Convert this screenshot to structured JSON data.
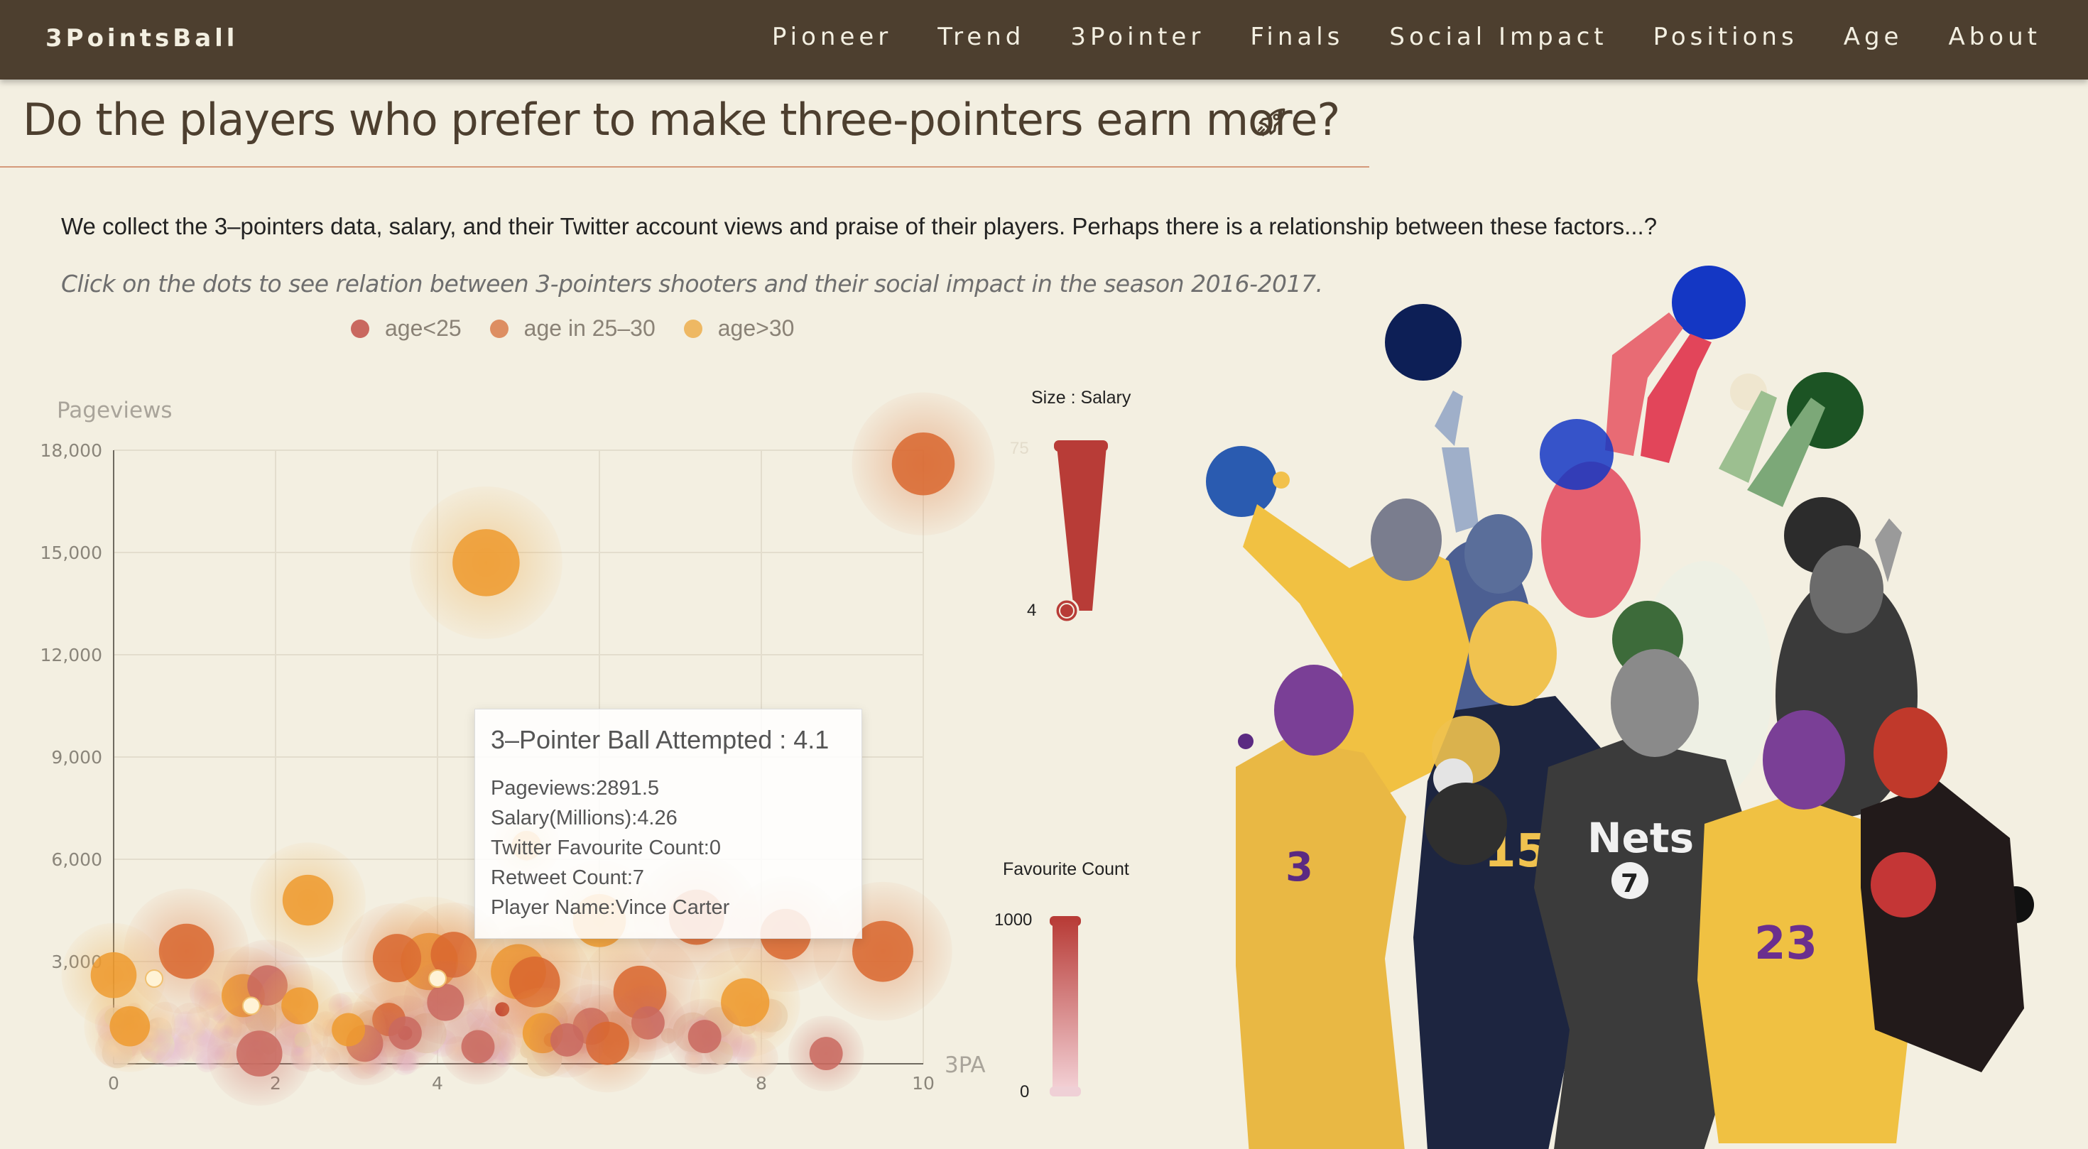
{
  "nav": {
    "brand": "3PointsBall",
    "links": [
      "Pioneer",
      "Trend",
      "3Pointer",
      "Finals",
      "Social Impact",
      "Positions",
      "Age",
      "About"
    ]
  },
  "header": {
    "title": "Do the players who prefer to make three-pointers earn more?",
    "intro": "We collect the 3–pointers data, salary, and their Twitter account views and praise of their players. Perhaps there is a relationship between these factors...?",
    "hint": "Click on the dots to see relation between 3-pointers shooters and their social impact in the season 2016-2017."
  },
  "legend": [
    {
      "label": "age<25",
      "color": "#c9685f"
    },
    {
      "label": "age in 25–30",
      "color": "#dd8e62"
    },
    {
      "label": "age>30",
      "color": "#eeb863"
    }
  ],
  "size_map": {
    "title": "Size : Salary",
    "max": "75",
    "min": "4"
  },
  "favourite_map": {
    "title": "Favourite Count",
    "max": "1000",
    "min": "0"
  },
  "tooltip": {
    "title": "3–Pointer Ball Attempted : 4.1",
    "lines": [
      "Pageviews:2891.5",
      "Salary(Millions):4.26",
      "Twitter Favourite Count:0",
      "Retweet Count:7",
      "Player Name:Vince Carter"
    ]
  },
  "chart_data": {
    "type": "scatter",
    "xlabel": "3PA",
    "ylabel": "Pageviews",
    "xlim": [
      0,
      10
    ],
    "ylim": [
      0,
      18000
    ],
    "xticks": [
      "0",
      "2",
      "4",
      "8",
      "10"
    ],
    "yticks": [
      "18,000",
      "15,000",
      "12,000",
      "9,000",
      "6,000",
      "3,000"
    ],
    "points": [
      {
        "x": 10.0,
        "y": 17600,
        "salary": 30,
        "age": "25-30"
      },
      {
        "x": 4.6,
        "y": 14700,
        "salary": 35,
        "age": ">30"
      },
      {
        "x": 2.4,
        "y": 4800,
        "salary": 18,
        "age": ">30"
      },
      {
        "x": 0.9,
        "y": 3300,
        "salary": 22,
        "age": "25-30"
      },
      {
        "x": 9.5,
        "y": 3300,
        "salary": 28,
        "age": "25-30"
      },
      {
        "x": 8.3,
        "y": 3800,
        "salary": 18,
        "age": "25-30"
      },
      {
        "x": 7.2,
        "y": 4300,
        "salary": 22,
        "age": "25-30"
      },
      {
        "x": 6.0,
        "y": 4200,
        "salary": 20,
        "age": ">30"
      },
      {
        "x": 5.1,
        "y": 6400,
        "salary": 4.26,
        "age": ">30"
      },
      {
        "x": 3.9,
        "y": 3000,
        "salary": 24,
        "age": ">30"
      },
      {
        "x": 3.5,
        "y": 3100,
        "salary": 16,
        "age": "25-30"
      },
      {
        "x": 4.2,
        "y": 3200,
        "salary": 14,
        "age": "25-30"
      },
      {
        "x": 5.0,
        "y": 2700,
        "salary": 22,
        "age": ">30"
      },
      {
        "x": 5.2,
        "y": 2400,
        "salary": 18,
        "age": "25-30"
      },
      {
        "x": 6.5,
        "y": 2100,
        "salary": 20,
        "age": "25-30"
      },
      {
        "x": 7.8,
        "y": 1800,
        "salary": 16,
        "age": ">30"
      },
      {
        "x": 1.6,
        "y": 2000,
        "salary": 12,
        "age": ">30"
      },
      {
        "x": 1.9,
        "y": 2300,
        "salary": 10,
        "age": "<25"
      },
      {
        "x": 2.3,
        "y": 1700,
        "salary": 8,
        "age": ">30"
      },
      {
        "x": 0.0,
        "y": 2600,
        "salary": 14,
        "age": ">30"
      },
      {
        "x": 0.2,
        "y": 1100,
        "salary": 10,
        "age": ">30"
      },
      {
        "x": 8.8,
        "y": 300,
        "salary": 6,
        "age": "<25"
      },
      {
        "x": 6.6,
        "y": 1200,
        "salary": 6,
        "age": "<25"
      },
      {
        "x": 5.9,
        "y": 1100,
        "salary": 8,
        "age": "<25"
      },
      {
        "x": 6.1,
        "y": 600,
        "salary": 12,
        "age": "25-30"
      },
      {
        "x": 5.3,
        "y": 900,
        "salary": 10,
        "age": ">30"
      },
      {
        "x": 4.1,
        "y": 1800,
        "salary": 8,
        "age": "<25"
      },
      {
        "x": 3.4,
        "y": 1300,
        "salary": 6,
        "age": "25-30"
      },
      {
        "x": 3.1,
        "y": 600,
        "salary": 8,
        "age": "<25"
      },
      {
        "x": 2.9,
        "y": 1000,
        "salary": 6,
        "age": ">30"
      },
      {
        "x": 1.8,
        "y": 300,
        "salary": 14,
        "age": "<25"
      },
      {
        "x": 4.5,
        "y": 500,
        "salary": 6,
        "age": "<25"
      },
      {
        "x": 5.6,
        "y": 700,
        "salary": 6,
        "age": "<25"
      },
      {
        "x": 3.6,
        "y": 900,
        "salary": 6,
        "age": "<25"
      },
      {
        "x": 7.3,
        "y": 800,
        "salary": 6,
        "age": "<25"
      }
    ]
  }
}
